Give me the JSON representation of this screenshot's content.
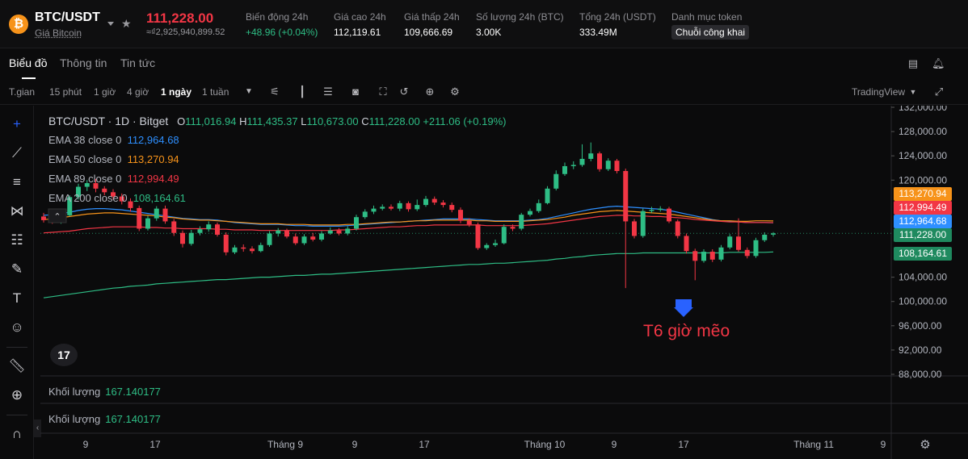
{
  "header": {
    "coin_icon": "bitcoin-icon",
    "pair": "BTC/USDT",
    "pair_sub": "Giá Bitcoin",
    "price": "111,228.00",
    "price_fiat": "≈₫2,925,940,899.52",
    "stats": [
      {
        "label": "Biến động 24h",
        "value": "+48.96 (+0.04%)",
        "color": "#2ebd85"
      },
      {
        "label": "Giá cao 24h",
        "value": "112,119.61"
      },
      {
        "label": "Giá thấp 24h",
        "value": "109,666.69"
      },
      {
        "label": "Số lượng 24h (BTC)",
        "value": "3.00K"
      },
      {
        "label": "Tổng 24h (USDT)",
        "value": "333.49M"
      },
      {
        "label": "Danh mục token",
        "value": "Chuỗi công khai"
      }
    ]
  },
  "tabs": [
    "Biểu đồ",
    "Thông tin",
    "Tin tức"
  ],
  "toolbar": {
    "items": [
      "T.gian",
      "15 phút",
      "1 giờ",
      "4 giờ",
      "1 ngày",
      "1 tuần"
    ],
    "active": "1 ngày",
    "tradingview": "TradingView"
  },
  "legend": {
    "title": "BTC/USDT · 1D · Bitget",
    "o": "111,016.94",
    "h": "111,435.37",
    "l": "110,673.00",
    "c": "111,228.00",
    "change": "+211.06 (+0.19%)",
    "ema": [
      {
        "label": "EMA 38 close 0",
        "value": "112,964.68",
        "color": "#2e8fff"
      },
      {
        "label": "EMA 50 close 0",
        "value": "113,270.94",
        "color": "#f7931a"
      },
      {
        "label": "EMA 89 close 0",
        "value": "112,994.49",
        "color": "#f23645"
      },
      {
        "label": "EMA 200 close 0",
        "value": "108,164.61",
        "color": "#2ebd85"
      }
    ]
  },
  "volume": [
    {
      "label": "Khối lượng",
      "value": "167.140177"
    },
    {
      "label": "Khối lượng",
      "value": "167.140177"
    }
  ],
  "annotation": "T6 giờ mẽo",
  "price_tags": [
    {
      "value": "113,270.94",
      "color": "#f7931a"
    },
    {
      "value": "112,994.49",
      "color": "#f23645"
    },
    {
      "value": "112,964.68",
      "color": "#2e8fff"
    },
    {
      "value": "111,228.00",
      "color": "#1f8a5f"
    },
    {
      "value": "108,164.61",
      "color": "#1f8a5f"
    }
  ],
  "chart_data": {
    "type": "line",
    "title": "BTC/USDT · 1D · Bitget",
    "y_ticks": [
      "132,000.00",
      "128,000.00",
      "124,000.00",
      "120,000.00",
      "104,000.00",
      "100,000.00",
      "96,000.00",
      "92,000.00",
      "88,000.00"
    ],
    "x_ticks": [
      "9",
      "17",
      "Tháng 9",
      "9",
      "17",
      "Tháng 10",
      "9",
      "17",
      "Tháng 11",
      "9"
    ],
    "ylim": [
      88000,
      132000
    ],
    "candles": [
      {
        "o": 114000,
        "c": 113400,
        "h": 114600,
        "l": 113000
      },
      {
        "o": 113400,
        "c": 113000,
        "h": 113700,
        "l": 112800
      },
      {
        "o": 113000,
        "c": 114200,
        "h": 114500,
        "l": 112800
      },
      {
        "o": 114200,
        "c": 117200,
        "h": 117500,
        "l": 114000
      },
      {
        "o": 117200,
        "c": 118900,
        "h": 119400,
        "l": 116800
      },
      {
        "o": 118900,
        "c": 119500,
        "h": 120000,
        "l": 118200
      },
      {
        "o": 119500,
        "c": 118600,
        "h": 120200,
        "l": 118000
      },
      {
        "o": 118600,
        "c": 118000,
        "h": 119000,
        "l": 117500
      },
      {
        "o": 118000,
        "c": 117300,
        "h": 118500,
        "l": 116800
      },
      {
        "o": 117300,
        "c": 116500,
        "h": 117800,
        "l": 116000
      },
      {
        "o": 116500,
        "c": 115400,
        "h": 117000,
        "l": 114800
      },
      {
        "o": 115400,
        "c": 112000,
        "h": 115800,
        "l": 111600
      },
      {
        "o": 112000,
        "c": 113700,
        "h": 114100,
        "l": 111700
      },
      {
        "o": 113700,
        "c": 115300,
        "h": 115700,
        "l": 113300
      },
      {
        "o": 115300,
        "c": 113200,
        "h": 115800,
        "l": 112800
      },
      {
        "o": 113200,
        "c": 111300,
        "h": 113600,
        "l": 110800
      },
      {
        "o": 111300,
        "c": 109500,
        "h": 111700,
        "l": 108900
      },
      {
        "o": 109500,
        "c": 111300,
        "h": 111800,
        "l": 109200
      },
      {
        "o": 111300,
        "c": 111900,
        "h": 112400,
        "l": 110900
      },
      {
        "o": 111900,
        "c": 112700,
        "h": 113200,
        "l": 111500
      },
      {
        "o": 112700,
        "c": 111000,
        "h": 113000,
        "l": 110700
      },
      {
        "o": 111000,
        "c": 108100,
        "h": 111400,
        "l": 107600
      },
      {
        "o": 108100,
        "c": 108900,
        "h": 109300,
        "l": 107800
      },
      {
        "o": 108900,
        "c": 108700,
        "h": 109400,
        "l": 108200
      },
      {
        "o": 108700,
        "c": 108300,
        "h": 109100,
        "l": 107900
      },
      {
        "o": 108300,
        "c": 109300,
        "h": 109700,
        "l": 108100
      },
      {
        "o": 109300,
        "c": 111200,
        "h": 111600,
        "l": 109000
      },
      {
        "o": 111200,
        "c": 111700,
        "h": 112100,
        "l": 110700
      },
      {
        "o": 111700,
        "c": 110700,
        "h": 112000,
        "l": 110400
      },
      {
        "o": 110700,
        "c": 109600,
        "h": 111200,
        "l": 109300
      },
      {
        "o": 109600,
        "c": 110700,
        "h": 111100,
        "l": 109300
      },
      {
        "o": 110700,
        "c": 110200,
        "h": 111300,
        "l": 109900
      },
      {
        "o": 110200,
        "c": 111200,
        "h": 111600,
        "l": 109900
      },
      {
        "o": 111200,
        "c": 111700,
        "h": 112200,
        "l": 111000
      },
      {
        "o": 111700,
        "c": 111200,
        "h": 112100,
        "l": 110900
      },
      {
        "o": 111200,
        "c": 112000,
        "h": 112400,
        "l": 110900
      },
      {
        "o": 112000,
        "c": 113900,
        "h": 114300,
        "l": 111700
      },
      {
        "o": 113900,
        "c": 114800,
        "h": 115200,
        "l": 113600
      },
      {
        "o": 114800,
        "c": 115300,
        "h": 115800,
        "l": 114400
      },
      {
        "o": 115300,
        "c": 115600,
        "h": 116000,
        "l": 115000
      },
      {
        "o": 115600,
        "c": 115300,
        "h": 116000,
        "l": 115000
      },
      {
        "o": 115300,
        "c": 116200,
        "h": 116600,
        "l": 114900
      },
      {
        "o": 116200,
        "c": 115200,
        "h": 116500,
        "l": 114800
      },
      {
        "o": 115200,
        "c": 115900,
        "h": 116800,
        "l": 114900
      },
      {
        "o": 115900,
        "c": 116900,
        "h": 117400,
        "l": 115600
      },
      {
        "o": 116900,
        "c": 116300,
        "h": 117300,
        "l": 115900
      },
      {
        "o": 116300,
        "c": 115900,
        "h": 116700,
        "l": 115500
      },
      {
        "o": 115900,
        "c": 115100,
        "h": 116300,
        "l": 114700
      },
      {
        "o": 115100,
        "c": 113300,
        "h": 115500,
        "l": 112900
      },
      {
        "o": 113300,
        "c": 112700,
        "h": 113700,
        "l": 112300
      },
      {
        "o": 112700,
        "c": 108800,
        "h": 113000,
        "l": 108500
      },
      {
        "o": 108800,
        "c": 109300,
        "h": 109600,
        "l": 108500
      },
      {
        "o": 109300,
        "c": 109600,
        "h": 110200,
        "l": 109000
      },
      {
        "o": 109600,
        "c": 112300,
        "h": 112700,
        "l": 109400
      },
      {
        "o": 112300,
        "c": 112000,
        "h": 112700,
        "l": 111600
      },
      {
        "o": 112000,
        "c": 114300,
        "h": 114600,
        "l": 111700
      },
      {
        "o": 114300,
        "c": 114900,
        "h": 115300,
        "l": 114000
      },
      {
        "o": 114900,
        "c": 116200,
        "h": 116800,
        "l": 114600
      },
      {
        "o": 116200,
        "c": 118600,
        "h": 119000,
        "l": 116000
      },
      {
        "o": 118600,
        "c": 121000,
        "h": 121600,
        "l": 118300
      },
      {
        "o": 121000,
        "c": 122300,
        "h": 122900,
        "l": 120700
      },
      {
        "o": 122300,
        "c": 122500,
        "h": 123100,
        "l": 121800
      },
      {
        "o": 122500,
        "c": 123500,
        "h": 125900,
        "l": 122200
      },
      {
        "o": 123500,
        "c": 124400,
        "h": 126200,
        "l": 123100
      },
      {
        "o": 124400,
        "c": 121800,
        "h": 124700,
        "l": 121400
      },
      {
        "o": 121800,
        "c": 123200,
        "h": 123600,
        "l": 121500
      },
      {
        "o": 123200,
        "c": 121500,
        "h": 123500,
        "l": 121100
      },
      {
        "o": 121500,
        "c": 113200,
        "h": 121900,
        "l": 102200
      },
      {
        "o": 113200,
        "c": 110800,
        "h": 113600,
        "l": 110400
      },
      {
        "o": 110800,
        "c": 114900,
        "h": 115300,
        "l": 110500
      },
      {
        "o": 114900,
        "c": 115100,
        "h": 115600,
        "l": 114600
      },
      {
        "o": 115100,
        "c": 115300,
        "h": 115700,
        "l": 114800
      },
      {
        "o": 115300,
        "c": 113200,
        "h": 115600,
        "l": 112900
      },
      {
        "o": 113200,
        "c": 110800,
        "h": 113500,
        "l": 110400
      },
      {
        "o": 110800,
        "c": 108300,
        "h": 111200,
        "l": 107900
      },
      {
        "o": 108300,
        "c": 106700,
        "h": 108700,
        "l": 103500
      },
      {
        "o": 106700,
        "c": 108200,
        "h": 108600,
        "l": 106400
      },
      {
        "o": 108200,
        "c": 106900,
        "h": 108600,
        "l": 106500
      },
      {
        "o": 106900,
        "c": 108900,
        "h": 109300,
        "l": 106600
      },
      {
        "o": 108900,
        "c": 110700,
        "h": 111100,
        "l": 108600
      },
      {
        "o": 110700,
        "c": 108500,
        "h": 113700,
        "l": 108200
      },
      {
        "o": 108500,
        "c": 107500,
        "h": 108900,
        "l": 107100
      },
      {
        "o": 107500,
        "c": 110100,
        "h": 110500,
        "l": 107200
      },
      {
        "o": 110100,
        "c": 111000,
        "h": 111400,
        "l": 109800
      },
      {
        "o": 111016.94,
        "c": 111228,
        "h": 111435.37,
        "l": 110673
      }
    ],
    "series": [
      {
        "name": "EMA 38",
        "color": "#2e8fff",
        "values": [
          114200,
          114300,
          114500,
          114700,
          115000,
          115200,
          115300,
          115300,
          115200,
          115100,
          114900,
          114700,
          114500,
          114300,
          114100,
          113900,
          113700,
          113600,
          113500,
          113500,
          113400,
          113200,
          113000,
          112900,
          112800,
          112700,
          112700,
          112700,
          112600,
          112500,
          112500,
          112400,
          112400,
          112400,
          112400,
          112500,
          112600,
          112700,
          112800,
          112900,
          113000,
          113100,
          113200,
          113300,
          113400,
          113500,
          113600,
          113600,
          113600,
          113600,
          113500,
          113400,
          113300,
          113300,
          113300,
          113300,
          113400,
          113500,
          113700,
          114000,
          114300,
          114600,
          114900,
          115200,
          115400,
          115600,
          115700,
          115600,
          115500,
          115400,
          115300,
          115200,
          115000,
          114700,
          114400,
          114100,
          113800,
          113500,
          113300,
          113200,
          113100,
          113000,
          113000,
          113000,
          112964.68
        ]
      },
      {
        "name": "EMA 50",
        "color": "#f7931a",
        "values": [
          113500,
          113600,
          113800,
          114000,
          114200,
          114400,
          114500,
          114600,
          114600,
          114500,
          114400,
          114300,
          114200,
          114100,
          113900,
          113800,
          113600,
          113500,
          113400,
          113400,
          113300,
          113200,
          113100,
          113000,
          112900,
          112800,
          112800,
          112800,
          112700,
          112700,
          112700,
          112600,
          112600,
          112600,
          112600,
          112700,
          112700,
          112800,
          112900,
          113000,
          113100,
          113100,
          113200,
          113300,
          113300,
          113400,
          113400,
          113400,
          113400,
          113400,
          113300,
          113300,
          113200,
          113200,
          113200,
          113200,
          113300,
          113400,
          113500,
          113700,
          113900,
          114200,
          114400,
          114600,
          114800,
          114900,
          115000,
          114900,
          114800,
          114700,
          114600,
          114500,
          114400,
          114200,
          114000,
          113800,
          113600,
          113400,
          113300,
          113300,
          113200,
          113200,
          113300,
          113300,
          113270.94
        ]
      },
      {
        "name": "EMA 89",
        "color": "#f23645",
        "values": [
          111300,
          111400,
          111500,
          111600,
          111800,
          112000,
          112100,
          112200,
          112300,
          112300,
          112300,
          112300,
          112200,
          112200,
          112100,
          112100,
          112000,
          112000,
          112000,
          112000,
          111900,
          111900,
          111800,
          111800,
          111800,
          111700,
          111700,
          111700,
          111700,
          111700,
          111700,
          111700,
          111700,
          111700,
          111800,
          111800,
          111900,
          112000,
          112100,
          112200,
          112300,
          112300,
          112400,
          112500,
          112500,
          112600,
          112600,
          112600,
          112600,
          112600,
          112600,
          112500,
          112500,
          112500,
          112500,
          112500,
          112600,
          112700,
          112800,
          113000,
          113200,
          113400,
          113600,
          113800,
          114000,
          114100,
          114200,
          114200,
          114100,
          114100,
          114000,
          114000,
          113900,
          113800,
          113700,
          113500,
          113400,
          113300,
          113200,
          113100,
          113100,
          113000,
          113000,
          113000,
          112994.49
        ]
      },
      {
        "name": "EMA 200",
        "color": "#2ebd85",
        "values": [
          100600,
          100800,
          101000,
          101200,
          101400,
          101600,
          101800,
          102000,
          102200,
          102300,
          102500,
          102600,
          102700,
          102900,
          103000,
          103100,
          103200,
          103300,
          103400,
          103500,
          103600,
          103600,
          103700,
          103800,
          103900,
          104000,
          104000,
          104100,
          104200,
          104300,
          104300,
          104400,
          104500,
          104500,
          104600,
          104700,
          104800,
          104900,
          105000,
          105100,
          105200,
          105300,
          105400,
          105500,
          105600,
          105700,
          105800,
          105900,
          106000,
          106100,
          106100,
          106200,
          106300,
          106300,
          106400,
          106500,
          106600,
          106700,
          106800,
          107000,
          107100,
          107300,
          107400,
          107600,
          107700,
          107800,
          107900,
          107900,
          107900,
          108000,
          108000,
          108000,
          108000,
          108000,
          108000,
          108000,
          108000,
          108000,
          108000,
          108100,
          108100,
          108100,
          108100,
          108100,
          108164.61
        ]
      }
    ]
  }
}
